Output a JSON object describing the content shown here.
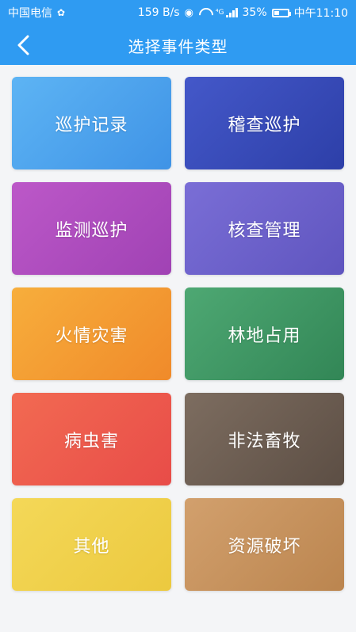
{
  "status": {
    "carrier": "中国电信",
    "speed": "159 B/s",
    "signal": "⁴G",
    "battery": "35%",
    "time": "中午11:10"
  },
  "header": {
    "title": "选择事件类型",
    "back_icon": "chevron-left-icon"
  },
  "colors": {
    "header": "#2f9bf2",
    "background": "#f4f5f7"
  },
  "cards": [
    {
      "label": "巡护记录",
      "color": "#4fa6ee"
    },
    {
      "label": "稽查巡护",
      "color": "#3a4fbf"
    },
    {
      "label": "监测巡护",
      "color": "#b04cc2"
    },
    {
      "label": "核查管理",
      "color": "#6e62cc"
    },
    {
      "label": "火情灾害",
      "color": "#f4a033"
    },
    {
      "label": "林地占用",
      "color": "#3f9a66"
    },
    {
      "label": "病虫害",
      "color": "#ee5b4c"
    },
    {
      "label": "非法畜牧",
      "color": "#6e5e52"
    },
    {
      "label": "其他",
      "color": "#f0d24e"
    },
    {
      "label": "资源破坏",
      "color": "#c9935e"
    }
  ]
}
